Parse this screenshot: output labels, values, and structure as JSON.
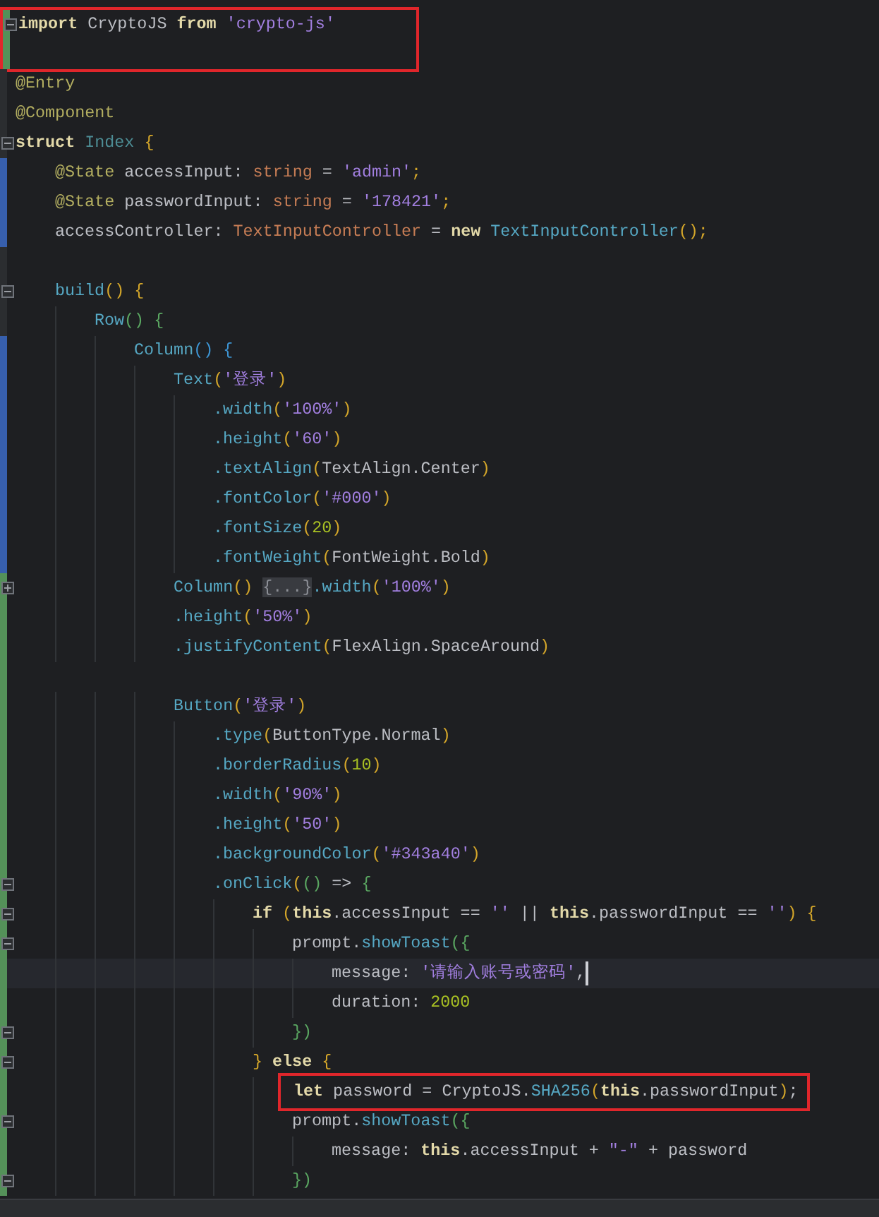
{
  "editor": {
    "lines": [
      {
        "added": true,
        "foldable": true,
        "collapsed": false,
        "boxed": true,
        "tokens": [
          {
            "kind": "kw",
            "text": "import"
          },
          {
            "kind": "plain",
            "text": " CryptoJS "
          },
          {
            "kind": "kw",
            "text": "from"
          },
          {
            "kind": "str",
            "text": " 'crypto-js'"
          }
        ]
      },
      {
        "added": true,
        "boxed": true
      },
      {
        "tokens": [
          {
            "kind": "ann",
            "text": "@Entry"
          }
        ]
      },
      {
        "tokens": [
          {
            "kind": "ann",
            "text": "@Component"
          }
        ]
      },
      {
        "foldable": true,
        "collapsed": false,
        "tokens": [
          {
            "kind": "kw",
            "text": "struct"
          },
          {
            "kind": "cls",
            "text": " Index"
          },
          {
            "kind": "b1",
            "text": " {"
          }
        ],
        "children": [
          {
            "modified": true,
            "tokens": [
              {
                "kind": "ann",
                "text": "@State"
              },
              {
                "kind": "plain",
                "text": " accessInput: "
              },
              {
                "kind": "type",
                "text": "string"
              },
              {
                "kind": "plain",
                "text": " = "
              },
              {
                "kind": "str",
                "text": "'admin'"
              },
              {
                "kind": "b1",
                "text": ";"
              }
            ]
          },
          {
            "modified": true,
            "tokens": [
              {
                "kind": "ann",
                "text": "@State"
              },
              {
                "kind": "plain",
                "text": " passwordInput: "
              },
              {
                "kind": "type",
                "text": "string"
              },
              {
                "kind": "plain",
                "text": " = "
              },
              {
                "kind": "str",
                "text": "'178421'"
              },
              {
                "kind": "b1",
                "text": ";"
              }
            ]
          },
          {
            "modified": true,
            "tokens": [
              {
                "kind": "plain",
                "text": "accessController: "
              },
              {
                "kind": "type",
                "text": "TextInputController"
              },
              {
                "kind": "plain",
                "text": " = "
              },
              {
                "kind": "kw",
                "text": "new"
              },
              {
                "kind": "fn",
                "text": " TextInputController"
              },
              {
                "kind": "b1",
                "text": "();"
              }
            ]
          },
          {
            "added": false,
            "modified": false
          },
          {
            "foldable": true,
            "collapsed": false,
            "tokens": [
              {
                "kind": "fn",
                "text": "build"
              },
              {
                "kind": "b1",
                "text": "()"
              },
              {
                "kind": "b1",
                "text": " {"
              }
            ],
            "children": [
              {
                "tokens": [
                  {
                    "kind": "fn",
                    "text": "Row"
                  },
                  {
                    "kind": "b2",
                    "text": "()"
                  },
                  {
                    "kind": "b2",
                    "text": " {"
                  }
                ],
                "children": [
                  {
                    "modified": true,
                    "tokens": [
                      {
                        "kind": "fn",
                        "text": "Column"
                      },
                      {
                        "kind": "b3",
                        "text": "()"
                      },
                      {
                        "kind": "b3",
                        "text": " {"
                      }
                    ],
                    "children": [
                      {
                        "modified": true,
                        "tokens": [
                          {
                            "kind": "fn",
                            "text": "Text"
                          },
                          {
                            "kind": "b1",
                            "text": "("
                          },
                          {
                            "kind": "str",
                            "text": "'登录'"
                          },
                          {
                            "kind": "b1",
                            "text": ")"
                          }
                        ],
                        "children": [
                          {
                            "modified": true,
                            "tokens": [
                              {
                                "kind": "fn",
                                "text": ".width"
                              },
                              {
                                "kind": "b1",
                                "text": "("
                              },
                              {
                                "kind": "str",
                                "text": "'100%'"
                              },
                              {
                                "kind": "b1",
                                "text": ")"
                              }
                            ]
                          },
                          {
                            "modified": true,
                            "tokens": [
                              {
                                "kind": "fn",
                                "text": ".height"
                              },
                              {
                                "kind": "b1",
                                "text": "("
                              },
                              {
                                "kind": "str",
                                "text": "'60'"
                              },
                              {
                                "kind": "b1",
                                "text": ")"
                              }
                            ]
                          },
                          {
                            "modified": true,
                            "tokens": [
                              {
                                "kind": "fn",
                                "text": ".textAlign"
                              },
                              {
                                "kind": "b1",
                                "text": "("
                              },
                              {
                                "kind": "plain",
                                "text": "TextAlign.Center"
                              },
                              {
                                "kind": "b1",
                                "text": ")"
                              }
                            ]
                          },
                          {
                            "modified": true,
                            "tokens": [
                              {
                                "kind": "fn",
                                "text": ".fontColor"
                              },
                              {
                                "kind": "b1",
                                "text": "("
                              },
                              {
                                "kind": "str",
                                "text": "'#000'"
                              },
                              {
                                "kind": "b1",
                                "text": ")"
                              }
                            ]
                          },
                          {
                            "modified": true,
                            "tokens": [
                              {
                                "kind": "fn",
                                "text": ".fontSize"
                              },
                              {
                                "kind": "b1",
                                "text": "("
                              },
                              {
                                "kind": "num",
                                "text": "20"
                              },
                              {
                                "kind": "b1",
                                "text": ")"
                              }
                            ]
                          },
                          {
                            "modified": true,
                            "tokens": [
                              {
                                "kind": "fn",
                                "text": ".fontWeight"
                              },
                              {
                                "kind": "b1",
                                "text": "("
                              },
                              {
                                "kind": "plain",
                                "text": "FontWeight.Bold"
                              },
                              {
                                "kind": "b1",
                                "text": ")"
                              }
                            ]
                          }
                        ]
                      },
                      {
                        "added": true,
                        "foldable": true,
                        "collapsed": true,
                        "tokens": [
                          {
                            "kind": "fn",
                            "text": "Column"
                          },
                          {
                            "kind": "b1",
                            "text": "() "
                          },
                          {
                            "kind": "folded",
                            "text": "{...}"
                          },
                          {
                            "kind": "fn",
                            "text": ".width"
                          },
                          {
                            "kind": "b1",
                            "text": "("
                          },
                          {
                            "kind": "str",
                            "text": "'100%'"
                          },
                          {
                            "kind": "b1",
                            "text": ")"
                          }
                        ]
                      },
                      {
                        "added": true,
                        "tokens": [
                          {
                            "kind": "fn",
                            "text": ".height"
                          },
                          {
                            "kind": "b1",
                            "text": "("
                          },
                          {
                            "kind": "str",
                            "text": "'50%'"
                          },
                          {
                            "kind": "b1",
                            "text": ")"
                          }
                        ]
                      },
                      {
                        "added": true,
                        "tokens": [
                          {
                            "kind": "fn",
                            "text": ".justifyContent"
                          },
                          {
                            "kind": "b1",
                            "text": "("
                          },
                          {
                            "kind": "plain",
                            "text": "FlexAlign.SpaceAround"
                          },
                          {
                            "kind": "b1",
                            "text": ")"
                          }
                        ]
                      },
                      {
                        "added": true
                      },
                      {
                        "added": true,
                        "tokens": [
                          {
                            "kind": "fn",
                            "text": "Button"
                          },
                          {
                            "kind": "b1",
                            "text": "("
                          },
                          {
                            "kind": "str",
                            "text": "'登录'"
                          },
                          {
                            "kind": "b1",
                            "text": ")"
                          }
                        ],
                        "children": [
                          {
                            "added": true,
                            "tokens": [
                              {
                                "kind": "fn",
                                "text": ".type"
                              },
                              {
                                "kind": "b1",
                                "text": "("
                              },
                              {
                                "kind": "plain",
                                "text": "ButtonType.Normal"
                              },
                              {
                                "kind": "b1",
                                "text": ")"
                              }
                            ]
                          },
                          {
                            "added": true,
                            "tokens": [
                              {
                                "kind": "fn",
                                "text": ".borderRadius"
                              },
                              {
                                "kind": "b1",
                                "text": "("
                              },
                              {
                                "kind": "num",
                                "text": "10"
                              },
                              {
                                "kind": "b1",
                                "text": ")"
                              }
                            ]
                          },
                          {
                            "added": true,
                            "tokens": [
                              {
                                "kind": "fn",
                                "text": ".width"
                              },
                              {
                                "kind": "b1",
                                "text": "("
                              },
                              {
                                "kind": "str",
                                "text": "'90%'"
                              },
                              {
                                "kind": "b1",
                                "text": ")"
                              }
                            ]
                          },
                          {
                            "added": true,
                            "tokens": [
                              {
                                "kind": "fn",
                                "text": ".height"
                              },
                              {
                                "kind": "b1",
                                "text": "("
                              },
                              {
                                "kind": "str",
                                "text": "'50'"
                              },
                              {
                                "kind": "b1",
                                "text": ")"
                              }
                            ]
                          },
                          {
                            "added": true,
                            "tokens": [
                              {
                                "kind": "fn",
                                "text": ".backgroundColor"
                              },
                              {
                                "kind": "b1",
                                "text": "("
                              },
                              {
                                "kind": "str",
                                "text": "'#343a40'"
                              },
                              {
                                "kind": "b1",
                                "text": ")"
                              }
                            ]
                          },
                          {
                            "added": true,
                            "foldable": true,
                            "collapsed": false,
                            "tokens": [
                              {
                                "kind": "fn",
                                "text": ".onClick"
                              },
                              {
                                "kind": "b1",
                                "text": "("
                              },
                              {
                                "kind": "b2",
                                "text": "()"
                              },
                              {
                                "kind": "plain",
                                "text": " => "
                              },
                              {
                                "kind": "b2",
                                "text": "{"
                              }
                            ],
                            "children": [
                              {
                                "added": true,
                                "foldable": true,
                                "collapsed": false,
                                "tokens": [
                                  {
                                    "kind": "kw",
                                    "text": "if"
                                  },
                                  {
                                    "kind": "b1",
                                    "text": " ("
                                  },
                                  {
                                    "kind": "kw",
                                    "text": "this"
                                  },
                                  {
                                    "kind": "plain",
                                    "text": ".accessInput == "
                                  },
                                  {
                                    "kind": "str",
                                    "text": "''"
                                  },
                                  {
                                    "kind": "plain",
                                    "text": " || "
                                  },
                                  {
                                    "kind": "kw",
                                    "text": "this"
                                  },
                                  {
                                    "kind": "plain",
                                    "text": ".passwordInput == "
                                  },
                                  {
                                    "kind": "str",
                                    "text": "''"
                                  },
                                  {
                                    "kind": "b1",
                                    "text": ")"
                                  },
                                  {
                                    "kind": "b1",
                                    "text": " {"
                                  }
                                ],
                                "children": [
                                  {
                                    "added": true,
                                    "foldable": true,
                                    "collapsed": false,
                                    "tokens": [
                                      {
                                        "kind": "plain",
                                        "text": "prompt."
                                      },
                                      {
                                        "kind": "fn",
                                        "text": "showToast"
                                      },
                                      {
                                        "kind": "b2",
                                        "text": "({"
                                      }
                                    ],
                                    "children": [
                                      {
                                        "added": true,
                                        "current": true,
                                        "tokens": [
                                          {
                                            "kind": "plain",
                                            "text": "message: "
                                          },
                                          {
                                            "kind": "str",
                                            "text": "'请输入账号或密码'"
                                          },
                                          {
                                            "kind": "plain",
                                            "text": ","
                                          }
                                        ]
                                      },
                                      {
                                        "added": true,
                                        "tokens": [
                                          {
                                            "kind": "plain",
                                            "text": "duration: "
                                          },
                                          {
                                            "kind": "num",
                                            "text": "2000"
                                          }
                                        ]
                                      }
                                    ]
                                  },
                                  {
                                    "added": true,
                                    "foldable": true,
                                    "collapsed": false,
                                    "tokens": [
                                      {
                                        "kind": "b2",
                                        "text": "})"
                                      }
                                    ]
                                  }
                                ]
                              },
                              {
                                "added": true,
                                "foldable": true,
                                "collapsed": false,
                                "tokens": [
                                  {
                                    "kind": "b1",
                                    "text": "}"
                                  },
                                  {
                                    "kind": "kw",
                                    "text": " else"
                                  },
                                  {
                                    "kind": "b1",
                                    "text": " {"
                                  }
                                ],
                                "children": [
                                  {
                                    "added": true,
                                    "boxed": true,
                                    "tokens": [
                                      {
                                        "kind": "kw",
                                        "text": "let"
                                      },
                                      {
                                        "kind": "plain",
                                        "text": " password = CryptoJS."
                                      },
                                      {
                                        "kind": "fn",
                                        "text": "SHA256"
                                      },
                                      {
                                        "kind": "b1",
                                        "text": "("
                                      },
                                      {
                                        "kind": "kw",
                                        "text": "this"
                                      },
                                      {
                                        "kind": "plain",
                                        "text": ".passwordInput"
                                      },
                                      {
                                        "kind": "b1",
                                        "text": ")"
                                      },
                                      {
                                        "kind": "plain",
                                        "text": ";"
                                      }
                                    ]
                                  },
                                  {
                                    "added": true,
                                    "foldable": true,
                                    "collapsed": false,
                                    "tokens": [
                                      {
                                        "kind": "plain",
                                        "text": "prompt."
                                      },
                                      {
                                        "kind": "fn",
                                        "text": "showToast"
                                      },
                                      {
                                        "kind": "b2",
                                        "text": "({"
                                      }
                                    ],
                                    "children": [
                                      {
                                        "added": true,
                                        "tokens": [
                                          {
                                            "kind": "plain",
                                            "text": "message: "
                                          },
                                          {
                                            "kind": "kw",
                                            "text": "this"
                                          },
                                          {
                                            "kind": "plain",
                                            "text": ".accessInput + "
                                          },
                                          {
                                            "kind": "str",
                                            "text": "\"-\""
                                          },
                                          {
                                            "kind": "plain",
                                            "text": " + password"
                                          }
                                        ]
                                      }
                                    ]
                                  },
                                  {
                                    "added": true,
                                    "foldable": true,
                                    "collapsed": false,
                                    "tokens": [
                                      {
                                        "kind": "b2",
                                        "text": "})"
                                      }
                                    ]
                                  }
                                ]
                              }
                            ]
                          }
                        ]
                      }
                    ]
                  }
                ]
              }
            ]
          }
        ]
      }
    ]
  }
}
